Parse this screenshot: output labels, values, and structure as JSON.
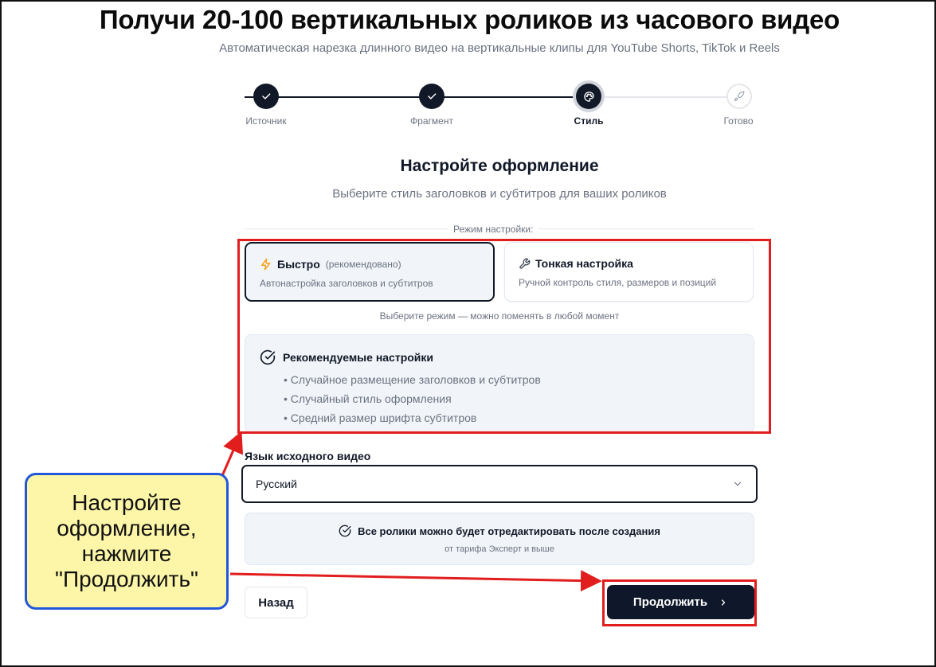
{
  "header": {
    "title": "Получи 20-100 вертикальных роликов из часового видео",
    "subtitle": "Автоматическая нарезка длинного видео на вертикальные клипы для YouTube Shorts, TikTok и Reels"
  },
  "stepper": {
    "steps": [
      {
        "label": "Источник",
        "state": "done",
        "icon": "check-icon"
      },
      {
        "label": "Фрагмент",
        "state": "done",
        "icon": "check-icon"
      },
      {
        "label": "Стиль",
        "state": "current",
        "icon": "palette-icon"
      },
      {
        "label": "Готово",
        "state": "upcoming",
        "icon": "rocket-icon"
      }
    ]
  },
  "section": {
    "title": "Настройте оформление",
    "subtitle": "Выберите стиль заголовков и субтитров для ваших роликов"
  },
  "mode": {
    "label": "Режим настройки:",
    "options": [
      {
        "title": "Быстро",
        "hint": "(рекомендовано)",
        "description": "Автонастройка заголовков и субтитров",
        "icon": "lightning-icon",
        "selected": true
      },
      {
        "title": "Тонкая настройка",
        "description": "Ручной контроль стиля, размеров и позиций",
        "icon": "wrench-icon",
        "selected": false
      }
    ],
    "note": "Выберите режим — можно поменять в любой момент"
  },
  "recommended": {
    "title": "Рекомендуемые настройки",
    "items": [
      "• Случайное размещение заголовков и субтитров",
      "• Случайный стиль оформления",
      "• Средний размер шрифта субтитров"
    ]
  },
  "language": {
    "label": "Язык исходного видео",
    "value": "Русский"
  },
  "edit_info": {
    "title": "Все ролики можно будет отредактировать после создания",
    "subtitle": "от тарифа Эксперт и выше"
  },
  "buttons": {
    "back": "Назад",
    "next": "Продолжить"
  },
  "annotation": {
    "line1": "Настройте",
    "line2": "оформление,",
    "line3": "нажмите",
    "line4": "\"Продолжить\""
  },
  "colors": {
    "primary": "#0f172a",
    "accent_lightning": "#f59e0b",
    "annotation_red": "#e11d1d",
    "callout_fill": "#fdf6a8",
    "callout_border": "#2357d9"
  }
}
